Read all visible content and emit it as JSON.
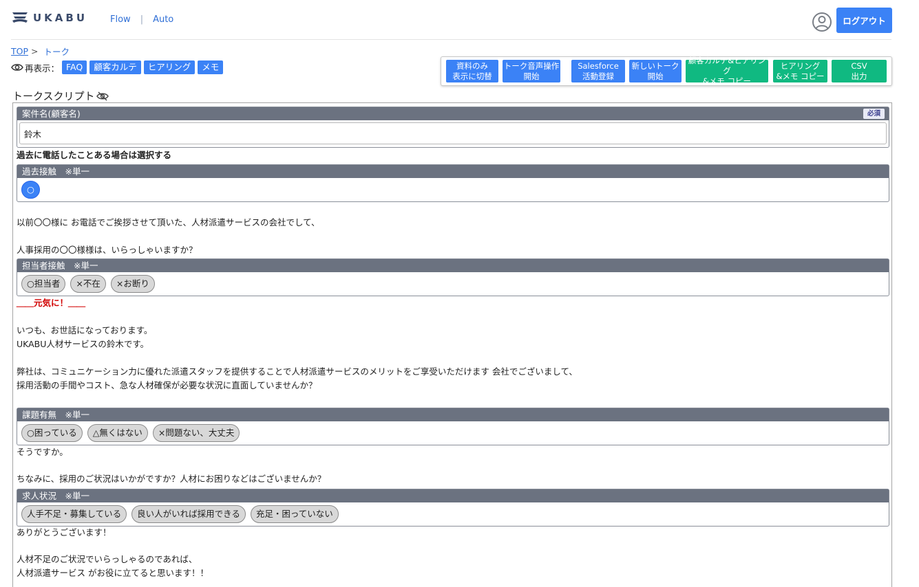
{
  "header": {
    "logo_text": "UKABU",
    "nav": [
      "Flow",
      "Auto"
    ],
    "nav_separator": "|",
    "logout_label": "ログアウト"
  },
  "breadcrumb": {
    "top": "TOP",
    "separator": ">",
    "current": "トーク"
  },
  "redisplay": {
    "label": "再表示：",
    "buttons": [
      "FAQ",
      "顧客カルテ",
      "ヒアリング",
      "メモ"
    ]
  },
  "actions": [
    {
      "line1": "資料のみ",
      "line2": "表示に切替",
      "color": "#3b82f6"
    },
    {
      "line1": "トーク音声操作",
      "line2": "開始",
      "color": "#3b82f6"
    },
    {
      "line1": "Salesforce",
      "line2": "活動登録",
      "color": "#3b82f6"
    },
    {
      "line1": "新しいトーク",
      "line2": "開始",
      "color": "#3b82f6"
    },
    {
      "line1": "顧客カルテ&ヒアリング",
      "line2": "&メモ コピー",
      "color": "#10b981"
    },
    {
      "line1": "ヒアリング",
      "line2": "&メモ コピー",
      "color": "#10b981"
    },
    {
      "line1": "CSV",
      "line2": "出力",
      "color": "#10b981"
    }
  ],
  "script": {
    "title": "トークスクリプト",
    "case_name": {
      "label": "案件名(顧客名)",
      "required": "必須",
      "value": "鈴木"
    },
    "past_note": "過去に電話したことある場合は選択する",
    "past_contact": {
      "label": "過去接触　※単一",
      "options": [
        "○"
      ]
    },
    "text1": [
      "以前〇〇様に お電話でご挨拶させて頂いた、人材派遣サービスの会社でして、",
      "",
      "人事採用の〇〇様様は、いらっしゃいますか？"
    ],
    "person_contact": {
      "label": "担当者接触　※単一",
      "options": [
        "○担当者",
        "×不在",
        "×お断り"
      ]
    },
    "cheer": "＿＿元気に！＿＿",
    "text2": [
      "いつも、お世話になっております。",
      "UKABU人材サービスの鈴木です。",
      "",
      "弊社は、コミュニケーション力に優れた派遣スタッフを提供することで人材派遣サービスのメリットをご享受いただけます 会社でございまして、",
      "採用活動の手間やコスト、急な人材確保が必要な状況に直面していませんか？"
    ],
    "issue": {
      "label": "課題有無　※単一",
      "options": [
        "○困っている",
        "△無くはない",
        "×問題ない、大丈夫"
      ]
    },
    "text3": [
      "そうですか。",
      "",
      "ちなみに、採用のご状況はいかがですか？人材にお困りなどはございませんか？"
    ],
    "hiring": {
      "label": "求人状況　※単一",
      "options": [
        "人手不足・募集している",
        "良い人がいれば採用できる",
        "充足・困っていない"
      ]
    },
    "text4": [
      "ありがとうございます！",
      "",
      "人材不足のご状況でいらっしゃるのであれば、",
      "人材派遣サービス がお役に立てると思います！！"
    ]
  }
}
